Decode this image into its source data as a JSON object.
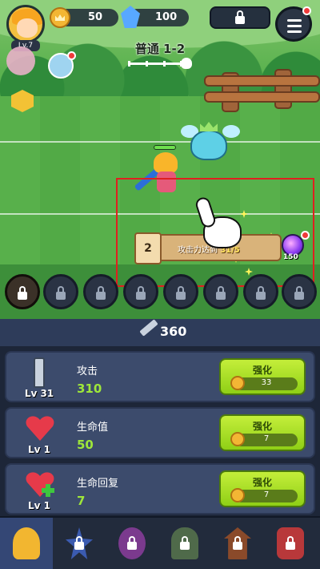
{
  "hud": {
    "player_level": "Lv.7",
    "crown_count": "50",
    "gem_count": "100",
    "stage_name": "普通 1-2"
  },
  "quest": {
    "number": "2",
    "text_prefix": "攻击力达到",
    "progress": "31/5",
    "reward": "150"
  },
  "power": {
    "value": "360"
  },
  "upgrades": [
    {
      "name": "攻击",
      "value": "310",
      "level": "Lv 31",
      "button": "强化",
      "cost": "33"
    },
    {
      "name": "生命值",
      "value": "50",
      "level": "Lv 1",
      "button": "强化",
      "cost": "7"
    },
    {
      "name": "生命回复",
      "value": "7",
      "level": "Lv 1",
      "button": "强化",
      "cost": "7"
    }
  ],
  "nav": [
    "helmet-icon",
    "star-icon",
    "paw-icon",
    "gate-icon",
    "tower-icon",
    "shop-icon"
  ],
  "colors": {
    "accent_green": "#9ee63a",
    "button_green": "#a8de22",
    "panel": "#3c4b6c",
    "highlight": "#e02020"
  }
}
